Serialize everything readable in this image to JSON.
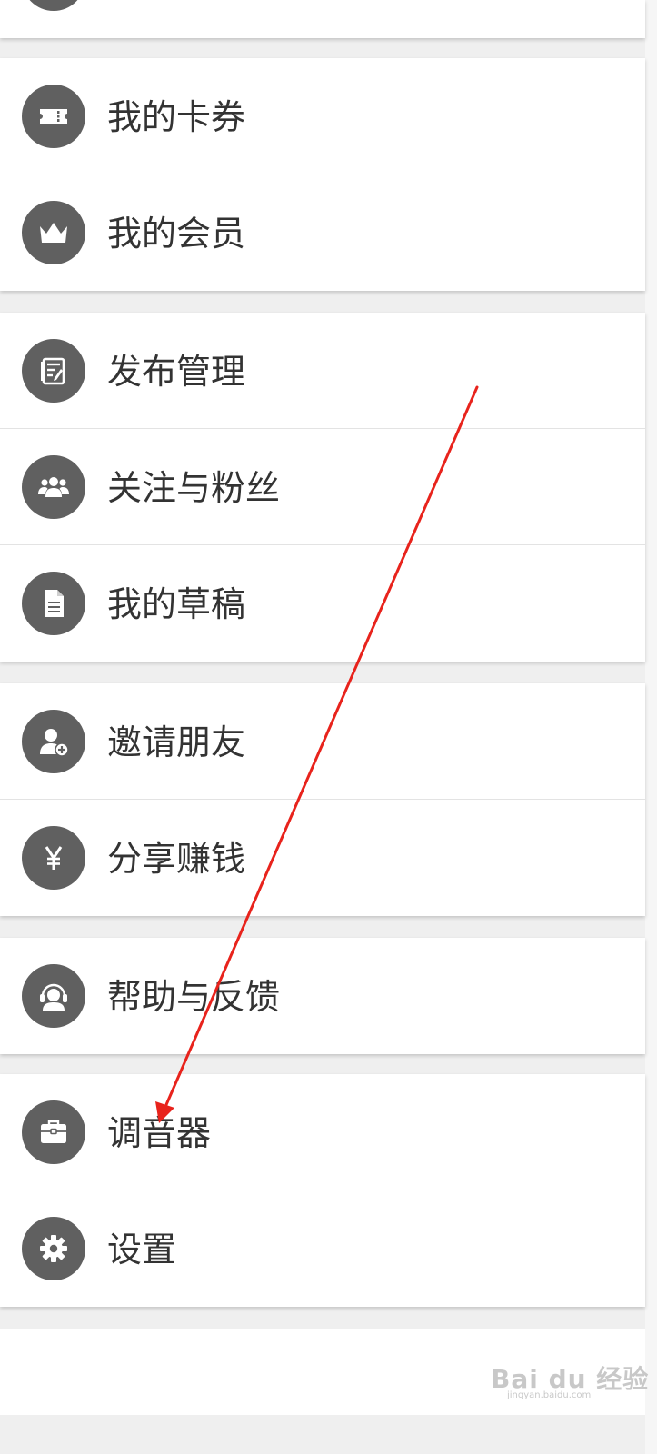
{
  "menu": {
    "groups": [
      {
        "items": [
          {
            "label": "我的卡券",
            "icon": "ticket-icon"
          },
          {
            "label": "我的会员",
            "icon": "crown-icon"
          }
        ]
      },
      {
        "items": [
          {
            "label": "发布管理",
            "icon": "publish-icon"
          },
          {
            "label": "关注与粉丝",
            "icon": "group-icon"
          },
          {
            "label": "我的草稿",
            "icon": "document-icon"
          }
        ]
      },
      {
        "items": [
          {
            "label": "邀请朋友",
            "icon": "add-user-icon"
          },
          {
            "label": "分享赚钱",
            "icon": "yen-icon"
          }
        ]
      },
      {
        "items": [
          {
            "label": "帮助与反馈",
            "icon": "headset-icon"
          }
        ]
      },
      {
        "items": [
          {
            "label": "调音器",
            "icon": "toolbox-icon"
          },
          {
            "label": "设置",
            "icon": "gear-icon"
          }
        ]
      }
    ]
  },
  "watermark": {
    "main": "Bai du 经验",
    "sub": "jingyan.baidu.com"
  },
  "colors": {
    "icon_bg": "#606060",
    "text": "#333333",
    "arrow": "#e8231c",
    "page_bg": "#efefef"
  }
}
